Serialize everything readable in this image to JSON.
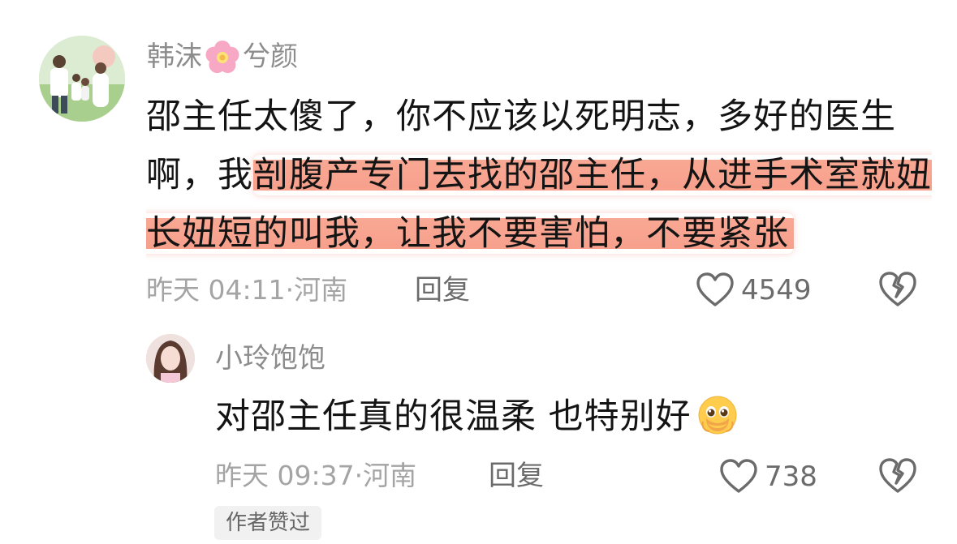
{
  "main_comment": {
    "username_prefix": "韩沫",
    "username_emoji": "flower-emoji",
    "username_suffix": "兮颜",
    "text_plain": "邵主任太傻了，你不应该以死明志，多好的医生啊，我",
    "text_highlight": "剖腹产专门去找的邵主任，从进手术室就妞长妞短的叫我，让我不要害怕，不要紧张",
    "time": "昨天 04:11",
    "separator": "·",
    "location": "河南",
    "reply_label": "回复",
    "like_count": "4549",
    "like_icon": "heart-outline-icon",
    "dislike_icon": "broken-heart-icon"
  },
  "reply_comment": {
    "username": "小玲饱饱",
    "text": "对邵主任真的很温柔 也特别好",
    "emoji": "pleading-face-emoji",
    "time": "昨天 09:37",
    "separator": "·",
    "location": "河南",
    "reply_label": "回复",
    "like_count": "738",
    "author_badge": "作者赞过"
  },
  "colors": {
    "highlight": "#f7a08c",
    "meta_gray": "#a4a4a4",
    "text_dark": "#141414"
  }
}
